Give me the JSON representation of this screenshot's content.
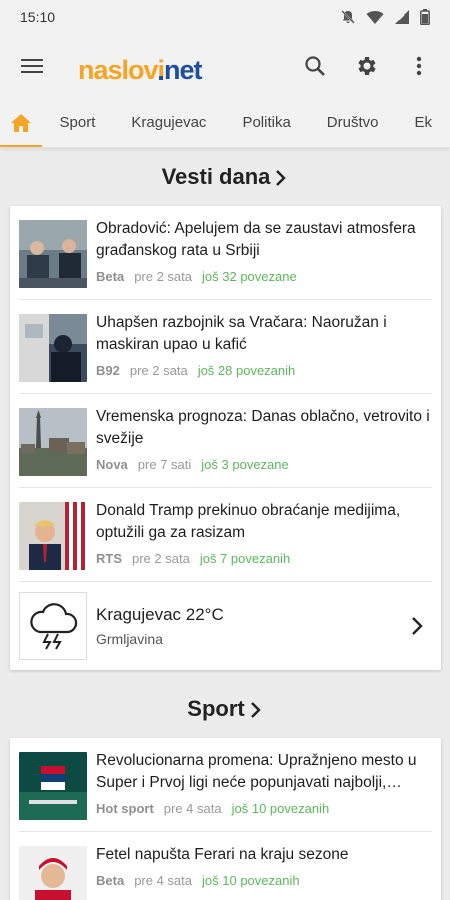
{
  "status": {
    "time": "15:10"
  },
  "app": {
    "logo_part1": "naslovi",
    "logo_part2": "net",
    "brand_color": "#f5a423",
    "brand_blue": "#1f4e9a"
  },
  "tabs": [
    {
      "label": "home-icon"
    },
    {
      "label": "Sport"
    },
    {
      "label": "Kragujevac"
    },
    {
      "label": "Politika"
    },
    {
      "label": "Društvo"
    },
    {
      "label": "Ek"
    }
  ],
  "sections": {
    "vesti": {
      "title": "Vesti dana",
      "items": [
        {
          "headline": "Obradović: Apelujem da se zaustavi atmosfera građanskog rata u Srbiji",
          "source": "Beta",
          "time": "pre 2 sata",
          "related": "još 32 povezane"
        },
        {
          "headline": "Uhapšen razbojnik sa Vračara: Naoružan i maskiran upao u kafić",
          "source": "B92",
          "time": "pre 2 sata",
          "related": "još 28 povezanih"
        },
        {
          "headline": "Vremenska prognoza: Danas oblačno, vetrovito i svežije",
          "source": "Nova",
          "time": "pre 7 sati",
          "related": "još 3 povezane"
        },
        {
          "headline": "Donald Tramp prekinuo obraćanje medijima, optužili ga za rasizam",
          "source": "RTS",
          "time": "pre 2 sata",
          "related": "još 7 povezanih"
        }
      ],
      "weather": {
        "city": "Kragujevac 22°C",
        "desc": "Grmljavina"
      }
    },
    "sport": {
      "title": "Sport",
      "items": [
        {
          "headline": "Revolucionarna promena: Upražnjeno mesto u Super i Prvoj ligi neće popunjavati najbolji,…",
          "source": "Hot sport",
          "time": "pre 4 sata",
          "related": "još 10 povezanih"
        },
        {
          "headline": "Fetel napušta Ferari na kraju sezone",
          "source": "Beta",
          "time": "pre 4 sata",
          "related": "još 10 povezanih"
        }
      ]
    }
  }
}
